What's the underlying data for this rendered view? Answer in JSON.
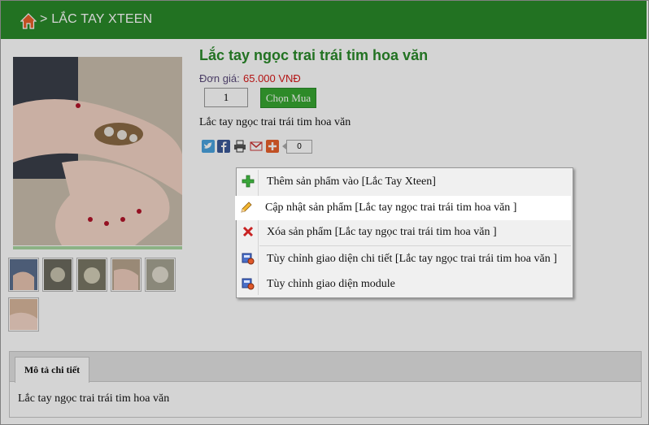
{
  "breadcrumb": {
    "separator": ">",
    "category": "LẮC TAY XTEEN"
  },
  "product": {
    "title": "Lắc tay ngọc trai trái tim hoa văn",
    "price_label": "Đơn giá:",
    "price_value": "65.000 VNĐ",
    "quantity": "1",
    "buy_label": "Chọn Mua",
    "short_description": "Lắc tay ngọc trai trái tim hoa văn",
    "share_count": "0"
  },
  "share_icons": [
    "twitter-icon",
    "facebook-icon",
    "print-icon",
    "email-icon",
    "addthis-plus-icon"
  ],
  "tabs": {
    "detail_label": "Mô tả chi tiết",
    "detail_content": "Lắc tay ngọc trai trái tim hoa văn"
  },
  "context_menu": {
    "items": [
      {
        "label": "Thêm sản phẩm vào [Lắc Tay Xteen]",
        "icon": "plus-icon"
      },
      {
        "label": "Cập nhật sản phẩm [Lắc tay ngọc trai trái tim hoa văn ]",
        "icon": "pencil-icon"
      },
      {
        "label": "Xóa sản phẩm [Lắc tay ngọc trai trái tim hoa văn ]",
        "icon": "delete-x-icon"
      },
      {
        "label": "Tùy chỉnh giao diện chi tiết [Lắc tay ngọc trai trái tim hoa văn ]",
        "icon": "customize-layout-icon"
      },
      {
        "label": "Tùy chỉnh giao diện module",
        "icon": "customize-module-icon"
      }
    ]
  },
  "colors": {
    "header_green": "#2a8a2a",
    "title_green": "#2a8a2a",
    "price_red": "#d81818",
    "buy_button": "#37a631"
  }
}
